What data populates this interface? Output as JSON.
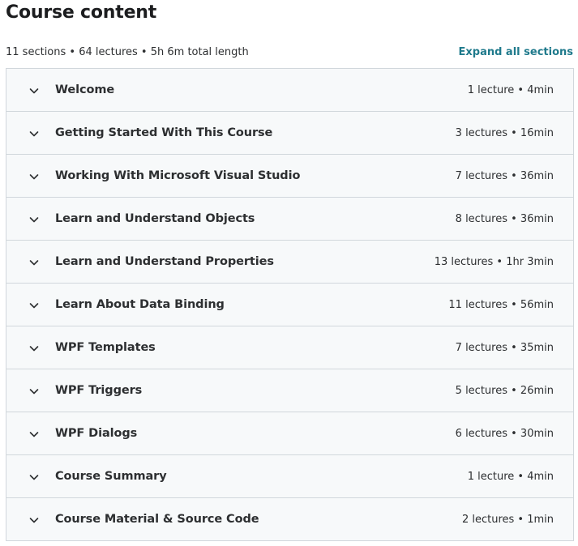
{
  "header": {
    "title": "Course content",
    "summary": "11 sections • 64 lectures • 5h 6m total length",
    "expand_label": "Expand all sections"
  },
  "colors": {
    "accent": "#1f7a8c",
    "section_bg": "#f7f9fa",
    "border": "#d1d7dc",
    "text": "#2d2f31"
  },
  "sections": [
    {
      "title": "Welcome",
      "stats": "1 lecture • 4min"
    },
    {
      "title": "Getting Started With This Course",
      "stats": "3 lectures • 16min"
    },
    {
      "title": "Working With Microsoft Visual Studio",
      "stats": "7 lectures • 36min"
    },
    {
      "title": "Learn and Understand Objects",
      "stats": "8 lectures • 36min"
    },
    {
      "title": "Learn and Understand Properties",
      "stats": "13 lectures • 1hr 3min"
    },
    {
      "title": "Learn About Data Binding",
      "stats": "11 lectures • 56min"
    },
    {
      "title": "WPF Templates",
      "stats": "7 lectures • 35min"
    },
    {
      "title": "WPF Triggers",
      "stats": "5 lectures • 26min"
    },
    {
      "title": "WPF Dialogs",
      "stats": "6 lectures • 30min"
    },
    {
      "title": "Course Summary",
      "stats": "1 lecture • 4min"
    },
    {
      "title": "Course Material & Source Code",
      "stats": "2 lectures • 1min"
    }
  ],
  "icons": {
    "section_toggle": "chevron-down-icon"
  }
}
